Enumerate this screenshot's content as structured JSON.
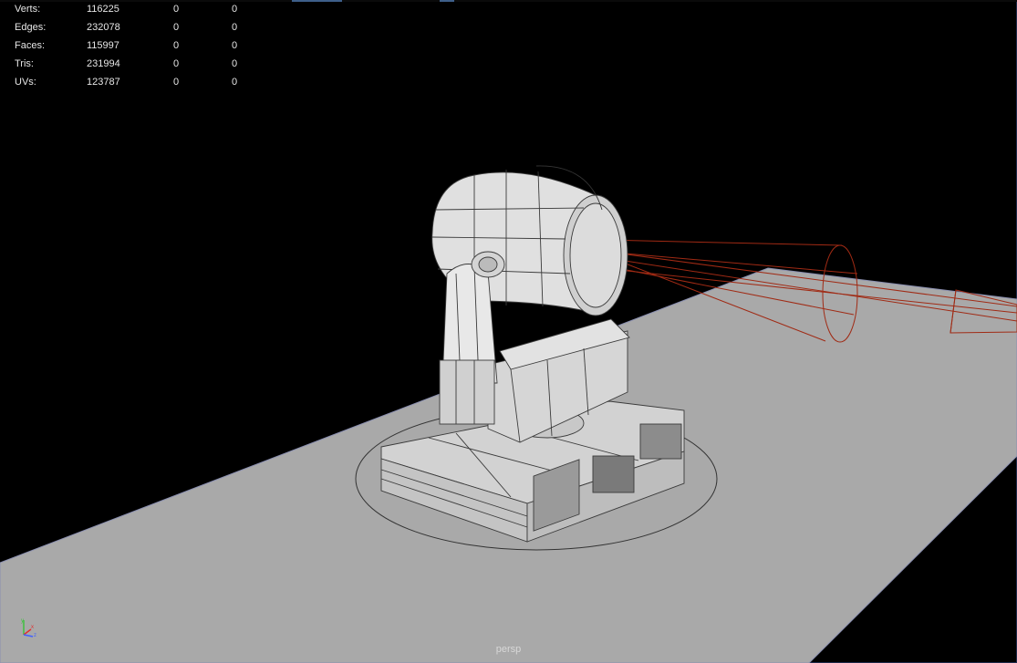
{
  "viewport": {
    "camera_name": "persp",
    "background_color": "#000000",
    "ground_color": "#a9a9a9",
    "light_cone_color": "#a02a14"
  },
  "hud": {
    "rows": [
      {
        "label": "Verts:",
        "total": "116225",
        "selected": "0",
        "selected_components": "0"
      },
      {
        "label": "Edges:",
        "total": "232078",
        "selected": "0",
        "selected_components": "0"
      },
      {
        "label": "Faces:",
        "total": "115997",
        "selected": "0",
        "selected_components": "0"
      },
      {
        "label": "Tris:",
        "total": "231994",
        "selected": "0",
        "selected_components": "0"
      },
      {
        "label": "UVs:",
        "total": "123787",
        "selected": "0",
        "selected_components": "0"
      }
    ]
  },
  "axis_gizmo": {
    "x_label": "x",
    "y_label": "y",
    "z_label": "z",
    "x_color": "#e03030",
    "y_color": "#40c040",
    "z_color": "#4060ff"
  }
}
